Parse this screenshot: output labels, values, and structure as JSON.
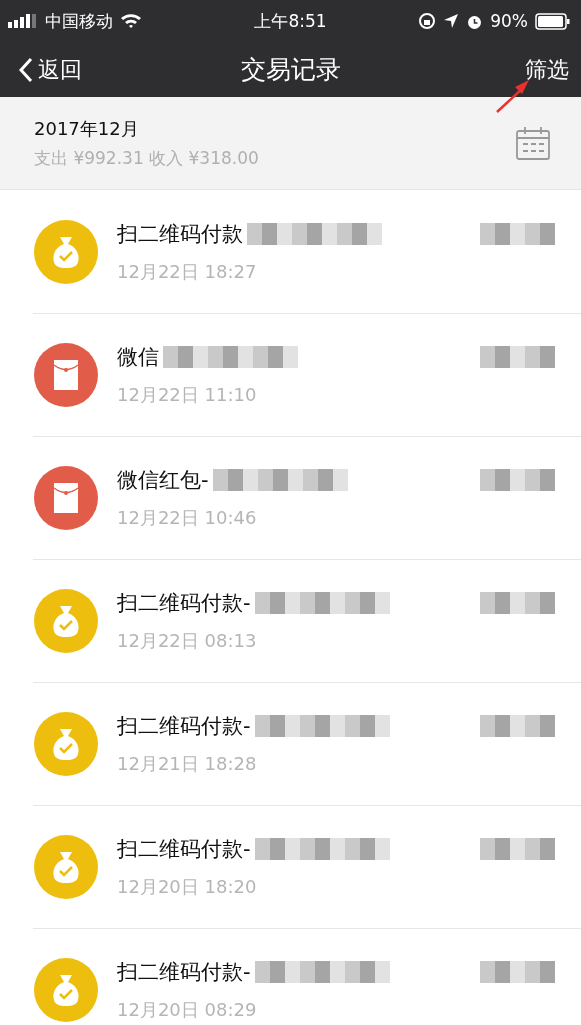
{
  "status_bar": {
    "carrier": "中国移动",
    "time": "上午8:51",
    "battery": "90%"
  },
  "nav": {
    "back": "返回",
    "title": "交易记录",
    "action": "筛选"
  },
  "summary": {
    "month": "2017年12月",
    "totals": "支出 ¥992.31 收入 ¥318.00"
  },
  "transactions": [
    {
      "kind": "qr",
      "title": "扫二维码付款",
      "date": "12月22日 18:27"
    },
    {
      "kind": "red_packet",
      "title": "微信",
      "date": "12月22日 11:10"
    },
    {
      "kind": "red_packet",
      "title": "微信红包-",
      "date": "12月22日 10:46"
    },
    {
      "kind": "qr",
      "title": "扫二维码付款-",
      "date": "12月22日 08:13"
    },
    {
      "kind": "qr",
      "title": "扫二维码付款-",
      "date": "12月21日 18:28"
    },
    {
      "kind": "qr",
      "title": "扫二维码付款-",
      "date": "12月20日 18:20"
    },
    {
      "kind": "qr",
      "title": "扫二维码付款-",
      "date": "12月20日 08:29"
    }
  ]
}
